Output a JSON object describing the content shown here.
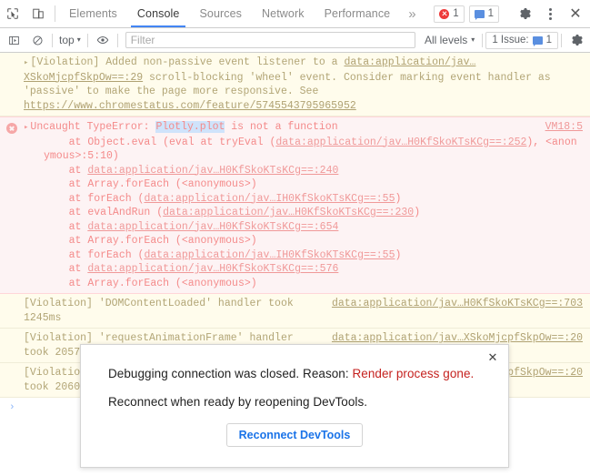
{
  "toolbar": {
    "inspect_icon": "inspect-element-icon",
    "device_icon": "device-toolbar-icon",
    "tabs": [
      {
        "label": "Elements",
        "active": false
      },
      {
        "label": "Console",
        "active": true
      },
      {
        "label": "Sources",
        "active": false
      },
      {
        "label": "Network",
        "active": false
      },
      {
        "label": "Performance",
        "active": false
      }
    ],
    "more_tabs": "»",
    "error_count": "1",
    "message_count": "1",
    "settings_icon": "gear-icon",
    "more_options_icon": "kebab-menu-icon",
    "close_label": "✕"
  },
  "filterbar": {
    "sidebar_icon": "console-sidebar-icon",
    "clear_icon": "clear-console-icon",
    "context": "top",
    "caret": "▾",
    "eye_icon": "live-expression-icon",
    "filter_placeholder": "Filter",
    "filter_value": "",
    "levels": "All levels",
    "levels_caret": "▾",
    "issues_label": "1 Issue:",
    "issues_count": "1",
    "settings_icon": "console-settings-gear-icon"
  },
  "console": {
    "violation1": {
      "disclosure": "▸",
      "text_a": "[Violation] Added non-passive event listener to a ",
      "link1": "data:application/jav…XSkoMjcpfSkpOw==:29",
      "text_b": " scroll-blocking 'wheel' event. Consider marking event handler as 'passive' to make the page more responsive. See ",
      "link2": "https://www.chromestatus.com/feature/5745543795965952"
    },
    "error": {
      "disclosure": "▸",
      "prefix": "Uncaught TypeError: ",
      "highlight": "Plotly.plot",
      "suffix": " is not a function",
      "source": "VM18:5",
      "stack": [
        {
          "pre": "    at Object.eval (eval at tryEval (",
          "link": "data:application/jav…H0KfSkoKTsKCg==:252",
          "post": "), <anonymous>:5:10)"
        },
        {
          "pre": "    at ",
          "link": "data:application/jav…H0KfSkoKTsKCg==:240",
          "post": ""
        },
        {
          "pre": "    at Array.forEach (<anonymous>)",
          "link": "",
          "post": ""
        },
        {
          "pre": "    at forEach (",
          "link": "data:application/jav…IH0KfSkoKTsKCg==:55",
          "post": ")"
        },
        {
          "pre": "    at evalAndRun (",
          "link": "data:application/jav…H0KfSkoKTsKCg==:230",
          "post": ")"
        },
        {
          "pre": "    at ",
          "link": "data:application/jav…H0KfSkoKTsKCg==:654",
          "post": ""
        },
        {
          "pre": "    at Array.forEach (<anonymous>)",
          "link": "",
          "post": ""
        },
        {
          "pre": "    at forEach (",
          "link": "data:application/jav…IH0KfSkoKTsKCg==:55",
          "post": ")"
        },
        {
          "pre": "    at ",
          "link": "data:application/jav…H0KfSkoKTsKCg==:576",
          "post": ""
        },
        {
          "pre": "    at Array.forEach (<anonymous>)",
          "link": "",
          "post": ""
        }
      ]
    },
    "violation2": {
      "text": "[Violation] 'DOMContentLoaded' handler took 1245ms",
      "link": "data:application/jav…H0KfSkoKTsKCg==:703"
    },
    "violation3": {
      "text": "[Violation] 'requestAnimationFrame' handler took 2057ms",
      "link": "data:application/jav…XSkoMjcpfSkpOw==:20"
    },
    "violation4": {
      "text": "[Violation] 'requestAnimationFrame' handler took 2060ms",
      "link": "data:application/jav…XSkoMjcpfSkpOw==:20"
    },
    "prompt_chevron": "›"
  },
  "dialog": {
    "close_label": "✕",
    "line1_prefix": "Debugging connection was closed. Reason: ",
    "line1_reason": "Render process gone.",
    "line2": "Reconnect when ready by reopening DevTools.",
    "button_label": "Reconnect DevTools"
  },
  "colors": {
    "accent": "#4285f4",
    "error_red": "#ee3a3a",
    "warn_bg": "#fffcec",
    "error_bg": "#fdf3f4",
    "link_blue": "#1a73e8",
    "reason_red": "#c5221f"
  }
}
